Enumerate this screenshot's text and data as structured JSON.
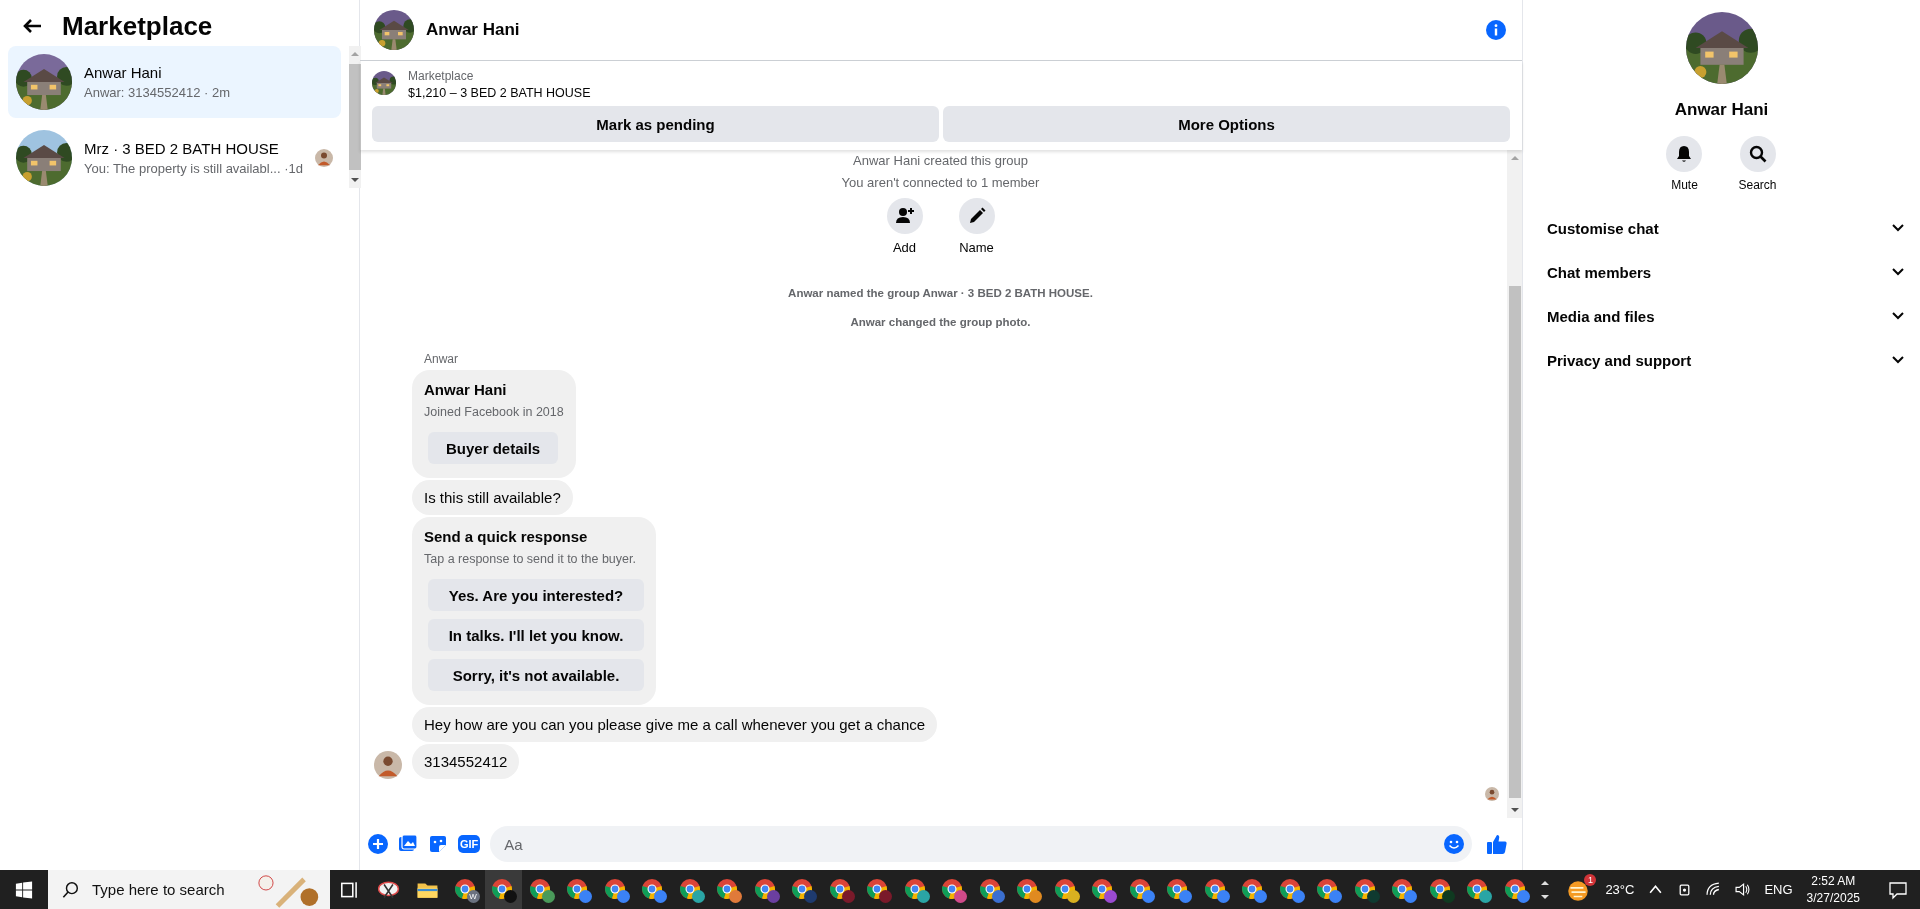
{
  "sidebar": {
    "title": "Marketplace",
    "conversations": [
      {
        "name": "Anwar Hani",
        "preview": "Anwar: 3134552412 · 2m",
        "selected": true,
        "seen_avatar": false
      },
      {
        "name": "Mrz · 3 BED 2 BATH HOUSE",
        "preview": "You: The property is still availabl... ·1d",
        "selected": false,
        "seen_avatar": true
      }
    ]
  },
  "chat": {
    "title": "Anwar Hani",
    "listing": {
      "label": "Marketplace",
      "title": "$1,210 – 3 BED 2 BATH HOUSE",
      "buttons": [
        "Mark as pending",
        "More Options"
      ]
    },
    "messages": [
      {
        "kind": "notice",
        "text": "Anwar Hani created this group"
      },
      {
        "kind": "notice",
        "text": "You aren't connected to 1 member"
      },
      {
        "kind": "actions",
        "items": [
          {
            "kind": "add",
            "label": "Add"
          },
          {
            "kind": "name",
            "label": "Name"
          }
        ]
      },
      {
        "kind": "event",
        "text": "Anwar named the group Anwar · 3 BED 2 BATH HOUSE."
      },
      {
        "kind": "event",
        "text": "Anwar changed the group photo."
      },
      {
        "kind": "sender",
        "text": "Anwar"
      },
      {
        "kind": "card",
        "title": "Anwar Hani",
        "subtitle": "Joined Facebook in 2018",
        "button": "Buyer details"
      },
      {
        "kind": "text",
        "text": "Is this still available?",
        "avatar": false
      },
      {
        "kind": "quick",
        "title": "Send a quick response",
        "subtitle": "Tap a response to send it to the buyer.",
        "options": [
          "Yes. Are you interested?",
          "In talks. I'll let you know.",
          "Sorry, it's not available."
        ]
      },
      {
        "kind": "text",
        "text": "Hey how are you can you please give me a call whenever you get a chance",
        "avatar": false
      },
      {
        "kind": "text",
        "text": "3134552412",
        "avatar": true
      }
    ],
    "composer": {
      "gif": "GIF",
      "placeholder": "Aa"
    }
  },
  "details": {
    "name": "Anwar Hani",
    "actions": [
      {
        "kind": "mute",
        "label": "Mute"
      },
      {
        "kind": "search",
        "label": "Search"
      }
    ],
    "sections": [
      {
        "label": "Customise chat",
        "expanded": false
      },
      {
        "label": "Chat members",
        "expanded": false
      },
      {
        "label": "Media and files",
        "expanded": false
      },
      {
        "label": "Privacy and support",
        "expanded": false
      }
    ]
  },
  "taskbar": {
    "search_placeholder": "Type here to search",
    "apps": [
      {
        "color": "#6b7280",
        "badge": "W"
      },
      {
        "color": "#111111",
        "selected": true
      },
      {
        "color": "#4a9a5a"
      },
      {
        "color": "#3b82f6"
      },
      {
        "color": "#3b82f6"
      },
      {
        "color": "#3b82f6"
      },
      {
        "color": "#2aa5a5"
      },
      {
        "color": "#e07a3a"
      },
      {
        "color": "#6b3fa0"
      },
      {
        "color": "#1e3a6e"
      },
      {
        "color": "#7a1a2a"
      },
      {
        "color": "#7a1a2a"
      },
      {
        "color": "#2aa5a5"
      },
      {
        "color": "#d04a8a"
      },
      {
        "color": "#3b6fd0"
      },
      {
        "color": "#e08a20"
      },
      {
        "color": "#d8b020"
      },
      {
        "color": "#9a4ad0"
      },
      {
        "color": "#3b82f6"
      },
      {
        "color": "#3b82f6"
      },
      {
        "color": "#3b82f6"
      },
      {
        "color": "#3b82f6"
      },
      {
        "color": "#3b82f6"
      },
      {
        "color": "#3b82f6"
      },
      {
        "color": "#0f3a30"
      },
      {
        "color": "#3b82f6"
      },
      {
        "color": "#0f3a20"
      },
      {
        "color": "#2aa5a5"
      },
      {
        "color": "#3b82f6"
      }
    ],
    "weather": {
      "badge": "1",
      "temp": "23°C"
    },
    "language": "ENG",
    "time": "2:52 AM",
    "date": "3/27/2025"
  }
}
